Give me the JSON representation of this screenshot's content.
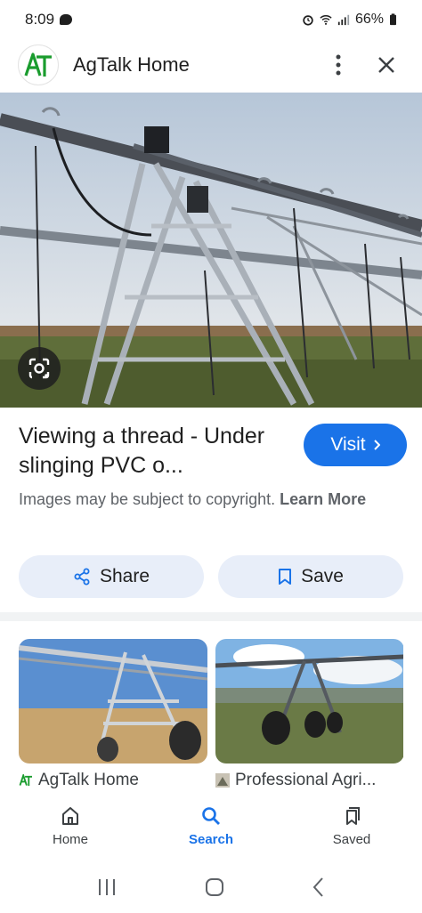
{
  "status_bar": {
    "time": "8:09",
    "battery": "66%",
    "icons": [
      "chat-icon",
      "alarm-icon",
      "wifi-icon",
      "signal-icon",
      "battery-icon"
    ]
  },
  "header": {
    "logo_text": "AT",
    "title": "AgTalk Home",
    "icons": [
      "more-vert-icon",
      "close-icon"
    ]
  },
  "hero": {
    "lens_icon": "lens-icon"
  },
  "result": {
    "title": "Viewing a thread - Under slinging PVC o...",
    "visit_label": "Visit",
    "copyright_text": "Images may be subject to copyright. ",
    "learn_more": "Learn More"
  },
  "actions": {
    "share_label": "Share",
    "save_label": "Save"
  },
  "related": [
    {
      "source": "AgTalk Home",
      "icon": "agtalk-favicon"
    },
    {
      "source": "Professional Agri...",
      "icon": "site-favicon"
    }
  ],
  "bottom_nav": {
    "items": [
      {
        "label": "Home",
        "icon": "home-icon"
      },
      {
        "label": "Search",
        "icon": "search-icon",
        "active": true
      },
      {
        "label": "Saved",
        "icon": "saved-icon"
      }
    ]
  },
  "system_nav": {
    "icons": [
      "recents-icon",
      "home-pill-icon",
      "back-icon"
    ]
  },
  "colors": {
    "accent": "#1a73e8",
    "pill_bg": "#e8eef9",
    "logo_green": "#1a9c2e"
  }
}
